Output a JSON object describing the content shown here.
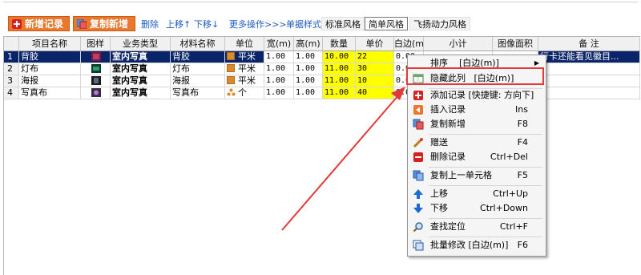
{
  "toolbar": {
    "new_record": "新增记录",
    "copy_new": "复制新增",
    "delete": "删除",
    "move_up": "上移↑",
    "move_down": "下移↓",
    "more_ops": "更多操作>>>",
    "form_style": "单据样式",
    "tabs": [
      "标准风格",
      "简单风格",
      "飞扬动力风格"
    ]
  },
  "grid": {
    "headers": [
      "项目名称",
      "图样",
      "业务类型",
      "材料名称",
      "单位",
      "宽(m)",
      "高(m)",
      "数量",
      "单价",
      "白边(m)",
      "小计",
      "图像面积",
      "备 注"
    ],
    "rows": [
      {
        "num": "1",
        "name": "背胶",
        "type": "室内写真",
        "material": "背胶",
        "unit": "平米",
        "w": "1.00",
        "h": "1.00",
        "qty": "10.00",
        "price": "22",
        "edge": "0.00",
        "remark": "行卡还能看见徽目..."
      },
      {
        "num": "2",
        "name": "灯布",
        "type": "室内写真",
        "material": "灯布",
        "unit": "平米",
        "w": "1.00",
        "h": "1.00",
        "qty": "11.00",
        "price": "30",
        "edge": "0.00",
        "remark": ""
      },
      {
        "num": "3",
        "name": "海报",
        "type": "室内写真",
        "material": "海报",
        "unit": "平米",
        "w": "1.00",
        "h": "1.00",
        "qty": "11.00",
        "price": "10",
        "edge": "0.00",
        "remark": ""
      },
      {
        "num": "4",
        "name": "写真布",
        "type": "室内写真",
        "material": "写真布",
        "unit": "个",
        "w": "1.00",
        "h": "1.00",
        "qty": "11.00",
        "price": "40",
        "edge": "0.00",
        "remark": ""
      }
    ]
  },
  "menu": {
    "sort": {
      "label": "排序",
      "value": "[白边(m)]"
    },
    "hide_col": {
      "label": "隐藏此列",
      "value": "[白边(m)]"
    },
    "add": {
      "label": "添加记录",
      "value": "[快捷键: 方向下]"
    },
    "insert": {
      "label": "插入记录",
      "shortcut": "Ins"
    },
    "copy_new": {
      "label": "复制新增",
      "shortcut": "F8"
    },
    "gift": {
      "label": "赠送",
      "shortcut": "F4"
    },
    "delete": {
      "label": "删除记录",
      "shortcut": "Ctrl+Del"
    },
    "copy_prev": {
      "label": "复制上一单元格",
      "shortcut": "F5"
    },
    "up": {
      "label": "上移",
      "shortcut": "Ctrl+Up"
    },
    "down": {
      "label": "下移",
      "shortcut": "Ctrl+Down"
    },
    "find": {
      "label": "查找定位",
      "shortcut": "Ctrl+F"
    },
    "batch": {
      "label": "批量修改",
      "value": "[白边(m)]",
      "shortcut": "F6"
    }
  },
  "colors": {
    "accent": "#e9772c",
    "selection": "#0a246a",
    "highlight": "#ffff00",
    "annotation": "#e23a3a"
  }
}
